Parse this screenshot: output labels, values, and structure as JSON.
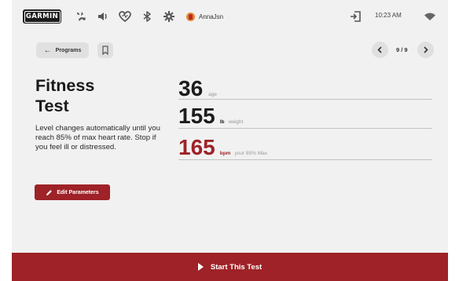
{
  "status_bar": {
    "brand": "GARMIN",
    "icons": [
      "fan-icon",
      "speaker-icon",
      "heart-icon",
      "bluetooth-icon",
      "settings-gear-icon",
      "user-avatar-icon",
      "logout-icon",
      "wifi-icon"
    ],
    "username": "AnnaJsn",
    "time": "10:23 AM"
  },
  "nav": {
    "back_label": "Programs",
    "page": "9 / 9"
  },
  "workout": {
    "title_line1": "Fitness",
    "title_line2": "Test",
    "description": "Level changes automatically until you reach 85% of max heart rate. Stop if you feel ill or distressed.",
    "edit_label": "Edit Parameters"
  },
  "metrics": {
    "age": {
      "value": "36",
      "label": "age"
    },
    "weight": {
      "value": "155",
      "unit": "lb",
      "label": "weight"
    },
    "heart_rate": {
      "value": "165",
      "unit": "bpm",
      "label": "your 85% Max"
    }
  },
  "footer": {
    "start_label": "Start This Test"
  },
  "colors": {
    "accent": "#9e2227",
    "screen_bg": "#f1f1f1",
    "button_bg": "#e0e0e0",
    "text_dark": "#1c1c1c"
  }
}
